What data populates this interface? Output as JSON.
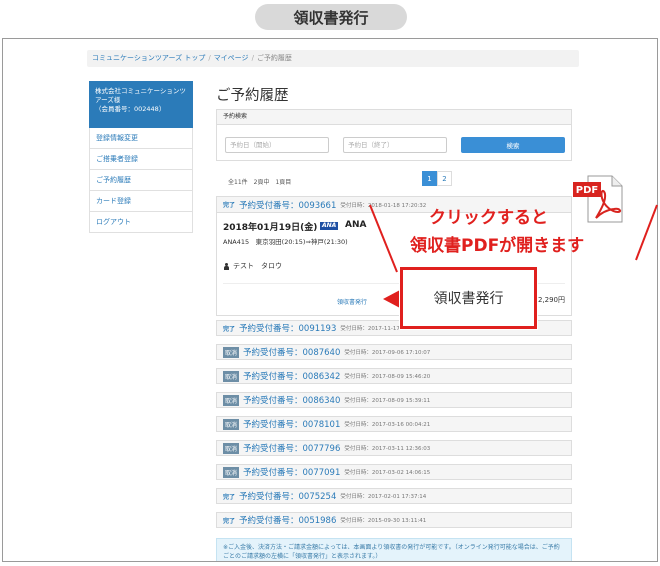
{
  "banner": {
    "title": "領収書発行"
  },
  "breadcrumb": {
    "items": [
      "コミュニケーションツアーズ トップ",
      "マイページ",
      "ご予約履歴"
    ],
    "separator": "/"
  },
  "sidebar": {
    "company_name": "株式会社コミュニケーションツアーズ様",
    "member_no": "（会員番号：002448）",
    "items": [
      "登録情報変更",
      "ご搭乗者登録",
      "ご予約履歴",
      "カード登録",
      "ログアウト"
    ]
  },
  "main": {
    "title": "ご予約履歴",
    "search": {
      "heading": "予約検索",
      "from_placeholder": "予約日（開始）",
      "to_placeholder": "予約日（終了）",
      "button": "検索"
    },
    "count_text": "全11件　2頁中　1頁目",
    "pagination": [
      "1",
      "2"
    ],
    "detail": {
      "status": "完了",
      "reservation_no": "予約受付番号：0093661",
      "received": "受付日時：2018-01-18 17:20:32",
      "flight_date": "2018年01月19日(金)",
      "airline_mark": "ANA",
      "airline": "ANA",
      "route": "ANA415　東京羽田(20:15)⇒神戸(21:30)",
      "passenger": "テスト　タロウ",
      "receipt_link": "領収書発行",
      "price": "2,290円"
    },
    "reservations": [
      {
        "status": "完了",
        "no": "予約受付番号：0091193",
        "date": "受付日時：2017-11-17"
      },
      {
        "status": "取消",
        "no": "予約受付番号：0087640",
        "date": "受付日時：2017-09-06 17:10:07"
      },
      {
        "status": "取消",
        "no": "予約受付番号：0086342",
        "date": "受付日時：2017-08-09 15:46:20"
      },
      {
        "status": "取消",
        "no": "予約受付番号：0086340",
        "date": "受付日時：2017-08-09 15:39:11"
      },
      {
        "status": "取消",
        "no": "予約受付番号：0078101",
        "date": "受付日時：2017-03-16 00:04:21"
      },
      {
        "status": "取消",
        "no": "予約受付番号：0077796",
        "date": "受付日時：2017-03-11 12:36:03"
      },
      {
        "status": "取消",
        "no": "予約受付番号：0077091",
        "date": "受付日時：2017-03-02 14:06:15"
      },
      {
        "status": "完了",
        "no": "予約受付番号：0075254",
        "date": "受付日時：2017-02-01 17:37:14"
      },
      {
        "status": "完了",
        "no": "予約受付番号：0051986",
        "date": "受付日時：2015-09-30 13:11:41"
      }
    ],
    "notice": "※ご入金後、決済方法・ご請求金額によっては、本画面より領収書の発行が可能です。（オンライン発行可能な場合は、ご予約ごとのご請求額の左横に「領収書発行」と表示されます。）"
  },
  "callout": {
    "line1": "クリックすると",
    "line2": "領収書PDFが開きます",
    "button_label": "領収書発行",
    "pdf_label": "PDF",
    "accent_color": "#e0201e"
  }
}
